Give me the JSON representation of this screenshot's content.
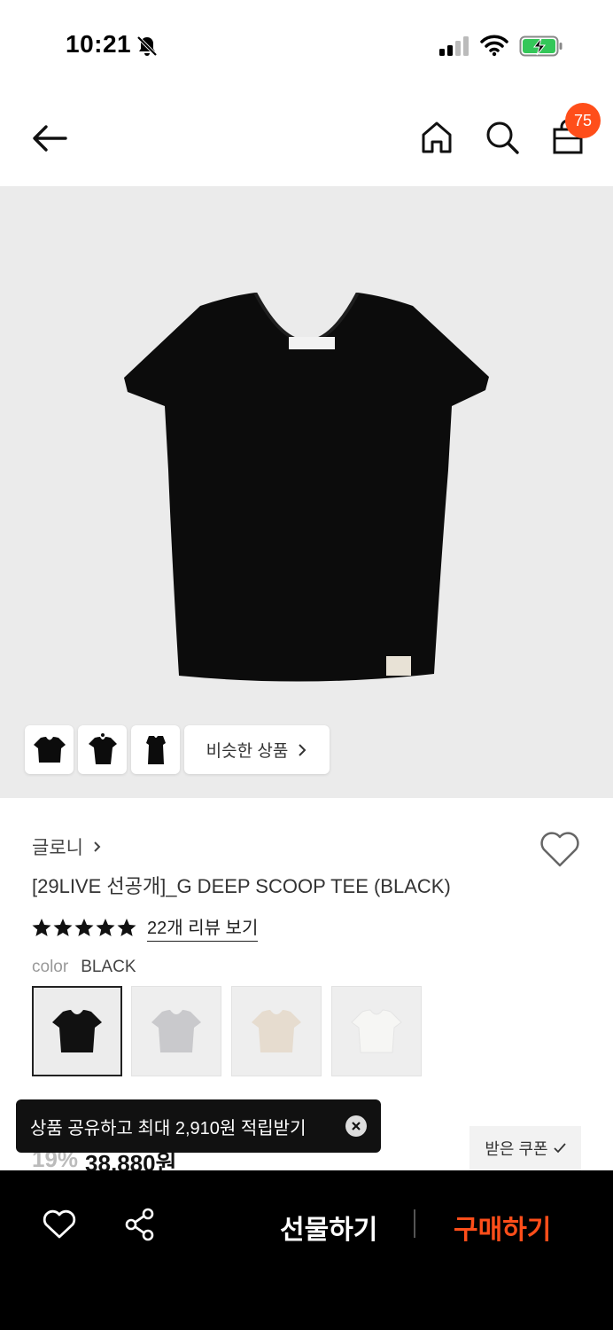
{
  "status": {
    "time": "10:21"
  },
  "nav": {
    "cart_count": "75"
  },
  "hero": {
    "similar_label": "비슷한 상품"
  },
  "product": {
    "brand": "글로니",
    "title": "[29LIVE 선공개]_G DEEP SCOOP TEE (BLACK)",
    "review_link": "22개 리뷰 보기",
    "rating_stars": 5,
    "color_label": "color",
    "color_value": "BLACK",
    "swatches": [
      {
        "name": "black",
        "color": "#111111",
        "selected": true
      },
      {
        "name": "grey",
        "color": "#c9c9cc",
        "selected": false
      },
      {
        "name": "beige",
        "color": "#e6dccf",
        "selected": false
      },
      {
        "name": "white",
        "color": "#f6f6f4",
        "selected": false
      }
    ],
    "discount": "19%",
    "price": "38,880원"
  },
  "toast": {
    "text": "상품 공유하고 최대 2,910원 적립받기"
  },
  "coupon": {
    "label": "받은 쿠폰"
  },
  "bottom": {
    "gift_label": "선물하기",
    "buy_label": "구매하기"
  },
  "colors": {
    "accent": "#ff4e1a",
    "hero_bg": "#ebebeb"
  }
}
